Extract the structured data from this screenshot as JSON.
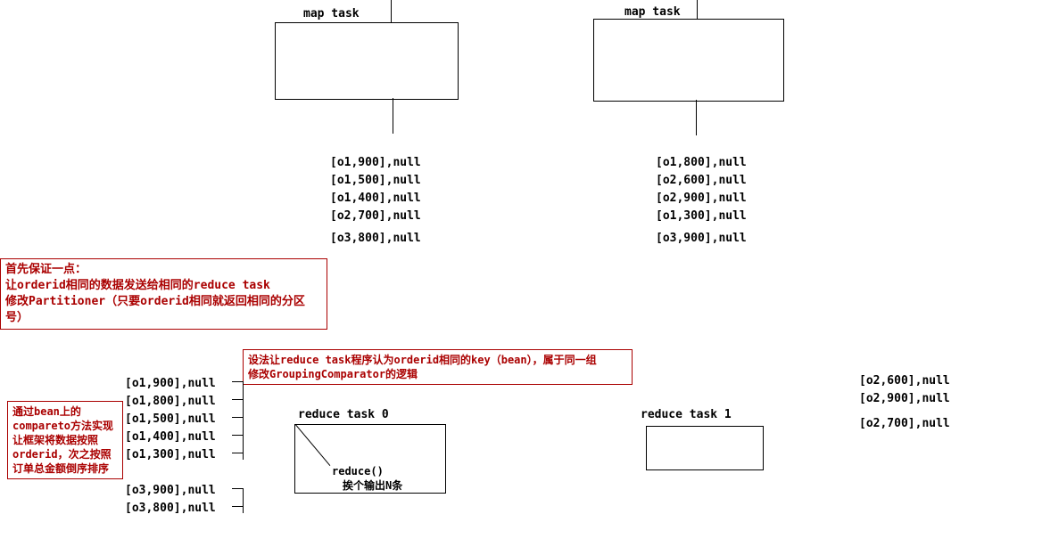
{
  "top": {
    "map_task_label": "map task",
    "left_data": [
      "[o1,900],null",
      "[o1,500],null",
      "[o1,400],null",
      "[o2,700],null",
      "[o3,800],null"
    ],
    "right_data": [
      "[o1,800],null",
      "[o2,600],null",
      "[o2,900],null",
      "[o1,300],null",
      "[o3,900],null"
    ]
  },
  "notes": {
    "note1": "首先保证一点：\n让orderid相同的数据发送给相同的reduce task\n修改Partitioner（只要orderid相同就返回相同的分区号）",
    "note2": "通过bean上的compareto方法实现让框架将数据按照orderid，次之按照订单总金额倒序排序",
    "note3": "设法让reduce task程序认为orderid相同的key（bean），属于同一组\n修改GroupingComparator的逻辑"
  },
  "reduce": {
    "merged_data": [
      "[o1,900],null",
      "[o1,800],null",
      "[o1,500],null",
      "[o1,400],null",
      "[o1,300],null",
      "[o3,900],null",
      "[o3,800],null"
    ],
    "task0_label": "reduce  task  0",
    "task0_inner1": "reduce()",
    "task0_inner2": "挨个输出N条",
    "task1_label": "reduce  task  1",
    "right_data": [
      "[o2,600],null",
      "[o2,900],null",
      "[o2,700],null"
    ]
  }
}
